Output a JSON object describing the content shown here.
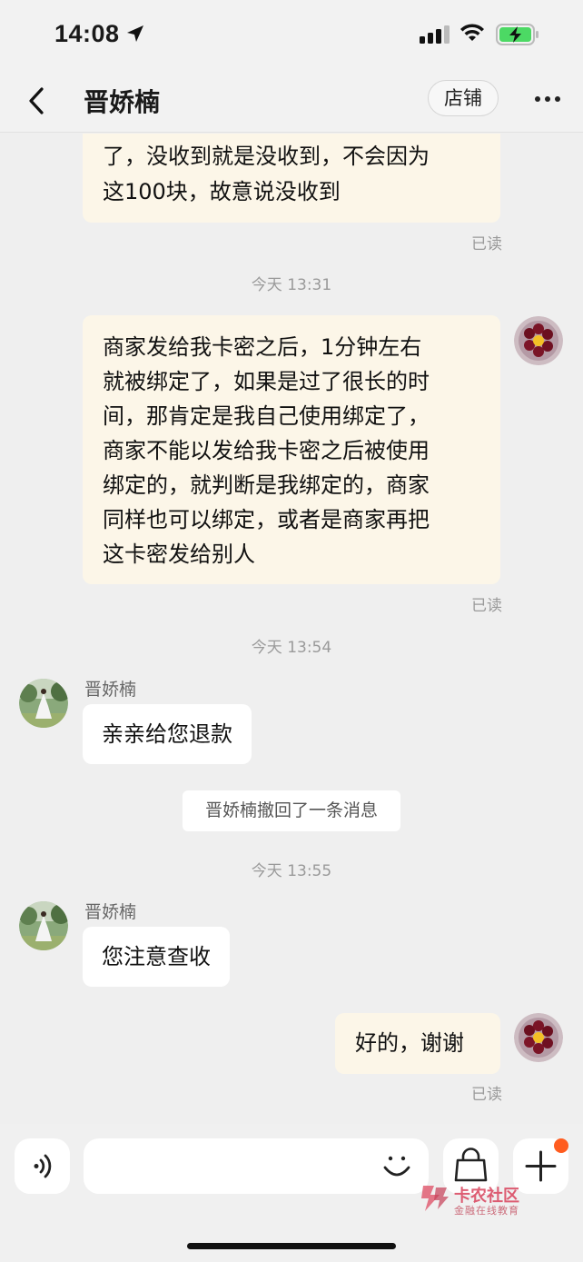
{
  "status_bar": {
    "time": "14:08"
  },
  "header": {
    "title": "晋娇楠",
    "shop_label": "店铺"
  },
  "messages": {
    "self_1_lines": [
      "了，没收到就是没收到，不会因为",
      "这100块，故意说没收到"
    ],
    "self_1_read": "已读",
    "time_1": "今天 13:31",
    "self_2_lines": [
      "商家发给我卡密之后，1分钟左右",
      "就被绑定了，如果是过了很长的时",
      "间，那肯定是我自己使用绑定了，",
      "商家不能以发给我卡密之后被使用",
      "绑定的，就判断是我绑定的，商家",
      "同样也可以绑定，或者是商家再把",
      "这卡密发给别人"
    ],
    "self_2_read": "已读",
    "time_2": "今天 13:54",
    "other_1_name": "晋娇楠",
    "other_1_text": "亲亲给您退款",
    "recall_notice": "晋娇楠撤回了一条消息",
    "time_3": "今天 13:55",
    "other_2_name": "晋娇楠",
    "other_2_text": "您注意查收",
    "self_3_text": "好的，谢谢",
    "self_3_read": "已读"
  },
  "input_bar": {
    "placeholder": ""
  },
  "watermark": {
    "title": "卡农社区",
    "subtitle": "金融在线教育"
  },
  "colors": {
    "self_bubble": "#fcf6e8",
    "other_bubble": "#ffffff",
    "background": "#efefef",
    "badge": "#ff5c1f"
  }
}
